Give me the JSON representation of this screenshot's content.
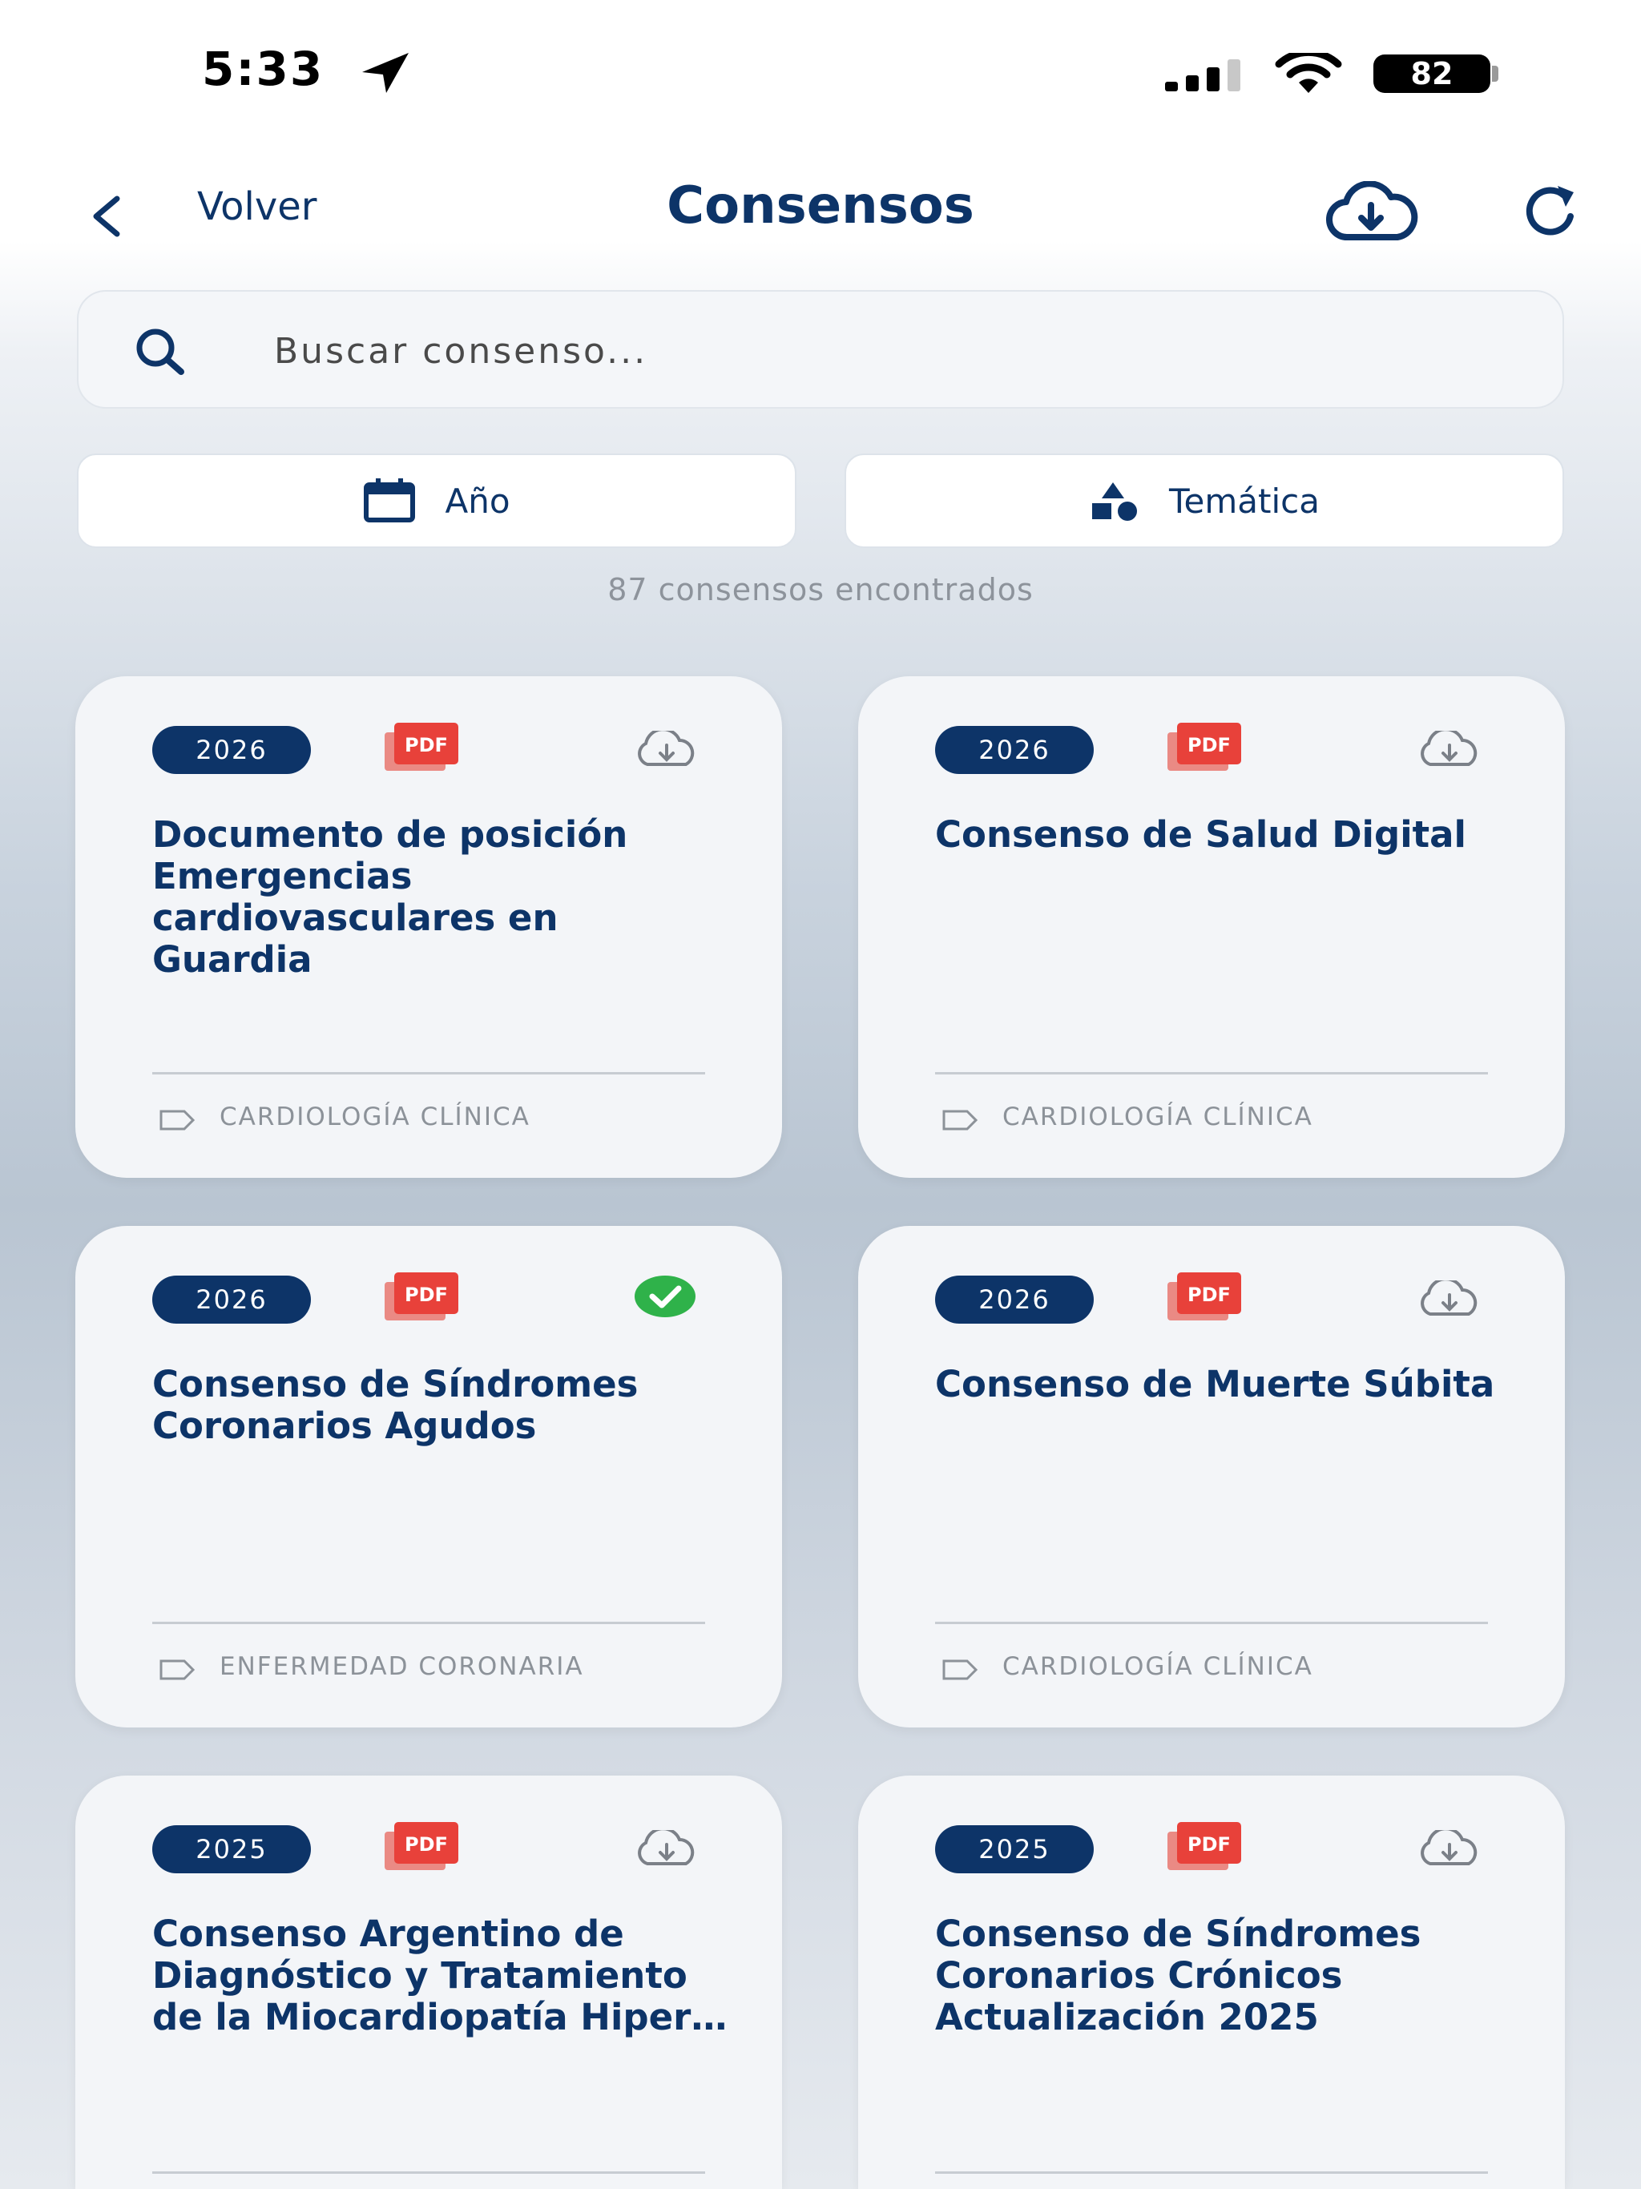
{
  "status": {
    "time": "5:33",
    "battery": "82"
  },
  "header": {
    "back_label": "Volver",
    "title": "Consensos"
  },
  "search": {
    "placeholder": "Buscar consenso..."
  },
  "filters": {
    "year_label": "Año",
    "topic_label": "Temática"
  },
  "results": {
    "count_text": "87 consensos encontrados"
  },
  "colors": {
    "primary": "#0d3468",
    "pdf_red": "#e8413a",
    "done_green": "#2fb24a"
  },
  "cards": [
    {
      "year": "2026",
      "title": "Documento de posición Emergencias cardiovasculares en Guardia",
      "topic": "CARDIOLOGÍA CLÍNICA",
      "download_state": "cloud-download-icon"
    },
    {
      "year": "2026",
      "title": "Consenso de Salud Digital",
      "topic": "CARDIOLOGÍA CLÍNICA",
      "download_state": "cloud-download-icon"
    },
    {
      "year": "2026",
      "title": "Consenso de Síndromes Coronarios Agudos",
      "topic": "ENFERMEDAD CORONARIA",
      "download_state": "downloaded-check-icon"
    },
    {
      "year": "2026",
      "title": "Consenso de Muerte Súbita",
      "topic": "CARDIOLOGÍA CLÍNICA",
      "download_state": "cloud-download-icon"
    },
    {
      "year": "2025",
      "title": "Consenso Argentino de Diagnóstico y Tratamiento de la Miocardiopatía Hiper…",
      "topic": "",
      "download_state": "cloud-download-icon"
    },
    {
      "year": "2025",
      "title": "Consenso de Síndromes Coronarios Crónicos Actualización 2025",
      "topic": "",
      "download_state": "cloud-download-icon"
    }
  ]
}
